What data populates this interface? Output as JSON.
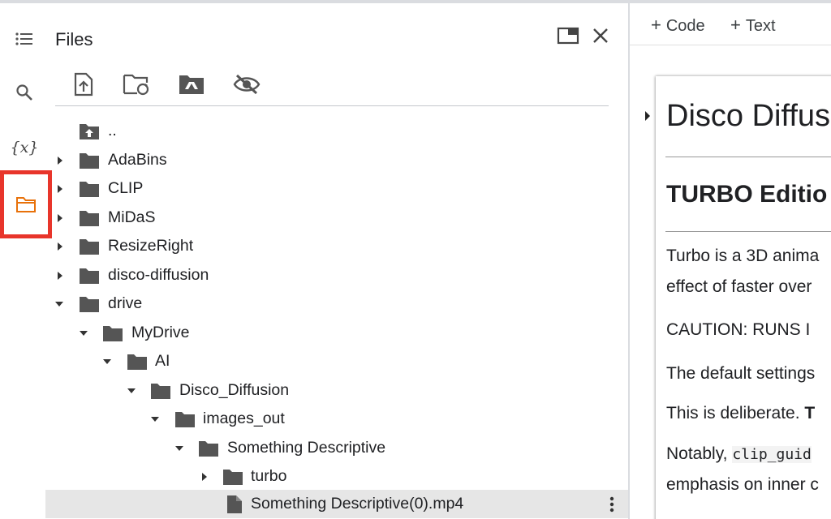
{
  "rail": {
    "items": [
      {
        "name": "table-of-contents"
      },
      {
        "name": "search"
      },
      {
        "name": "variables",
        "label": "{x}"
      },
      {
        "name": "files",
        "active": true
      }
    ],
    "active_color": "#e8710a",
    "highlight_color": "#e8352b"
  },
  "files_panel": {
    "title": "Files",
    "toolbar": [
      "upload-icon",
      "refresh-icon",
      "mount-drive-icon",
      "hide-icon"
    ],
    "tree": [
      {
        "label": "..",
        "type": "parent",
        "depth": 0
      },
      {
        "label": "AdaBins",
        "type": "folder",
        "depth": 0,
        "expanded": false
      },
      {
        "label": "CLIP",
        "type": "folder",
        "depth": 0,
        "expanded": false
      },
      {
        "label": "MiDaS",
        "type": "folder",
        "depth": 0,
        "expanded": false
      },
      {
        "label": "ResizeRight",
        "type": "folder",
        "depth": 0,
        "expanded": false
      },
      {
        "label": "disco-diffusion",
        "type": "folder",
        "depth": 0,
        "expanded": false
      },
      {
        "label": "drive",
        "type": "folder",
        "depth": 0,
        "expanded": true
      },
      {
        "label": "MyDrive",
        "type": "folder",
        "depth": 1,
        "expanded": true
      },
      {
        "label": "AI",
        "type": "folder",
        "depth": 2,
        "expanded": true
      },
      {
        "label": "Disco_Diffusion",
        "type": "folder",
        "depth": 3,
        "expanded": true
      },
      {
        "label": "images_out",
        "type": "folder",
        "depth": 4,
        "expanded": true
      },
      {
        "label": "Something Descriptive",
        "type": "folder",
        "depth": 5,
        "expanded": true
      },
      {
        "label": "turbo",
        "type": "folder",
        "depth": 6,
        "expanded": false
      },
      {
        "label": "Something Descriptive(0).mp4",
        "type": "file",
        "depth": 6,
        "selected": true
      }
    ]
  },
  "notebook": {
    "toolbar": {
      "code_label": "Code",
      "text_label": "Text"
    },
    "heading1": "Disco Diffus",
    "heading2": "TURBO Editio",
    "paragraphs": [
      "Turbo is a 3D anima",
      "effect of faster over",
      "CAUTION: RUNS I",
      "The default settings",
      "This is deliberate.",
      "Notably,",
      "emphasis on inner c"
    ],
    "para5_bold": "T",
    "para6_code": "clip_guid"
  }
}
